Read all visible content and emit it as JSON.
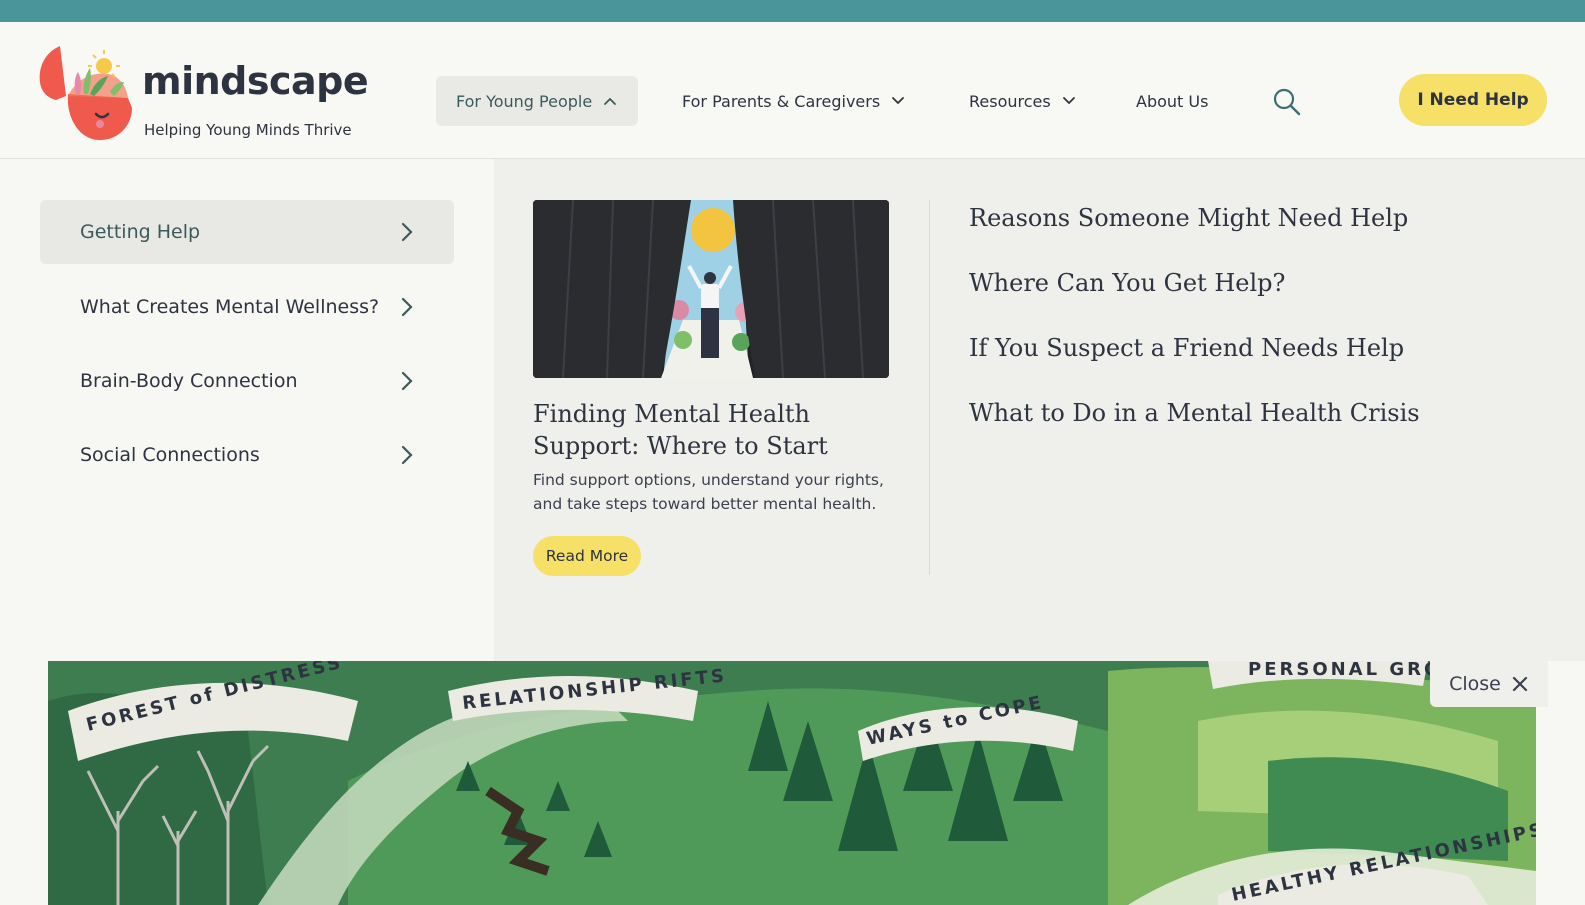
{
  "brand": {
    "name": "mindscape",
    "tagline": "Helping Young Minds Thrive"
  },
  "nav": {
    "items": [
      {
        "label": "For Young People",
        "state": "expanded"
      },
      {
        "label": "For Parents & Caregivers",
        "state": "collapsed"
      },
      {
        "label": "Resources",
        "state": "collapsed"
      },
      {
        "label": "About Us"
      }
    ],
    "help_label": "I Need Help"
  },
  "mega_menu": {
    "categories": [
      {
        "label": "Getting Help",
        "selected": true
      },
      {
        "label": "What Creates Mental Wellness?"
      },
      {
        "label": "Brain-Body Connection"
      },
      {
        "label": "Social Connections"
      }
    ],
    "feature": {
      "title": "Finding Mental Health Support: Where to Start",
      "description": "Find support options, understand your rights, and take steps toward better mental health.",
      "cta": "Read More"
    },
    "links": [
      "Reasons Someone Might Need Help",
      "Where Can You Get Help?",
      "If You Suspect a Friend Needs Help",
      "What to Do in a Mental Health Crisis"
    ],
    "close_label": "Close"
  },
  "hero_banners": [
    "FOREST of DISTRESS",
    "RELATIONSHIP RIFTS",
    "WAYS to COPE",
    "PERSONAL GRO",
    "HEALTHY RELATIONSHIPS"
  ],
  "colors": {
    "teal": "#4a9599",
    "accent_yellow": "#f6e067",
    "logo_red": "#ef5a4c",
    "text": "#2d3340"
  },
  "icons": [
    "search-icon",
    "chevron-up-icon",
    "chevron-down-icon",
    "chevron-right-icon",
    "close-icon"
  ]
}
